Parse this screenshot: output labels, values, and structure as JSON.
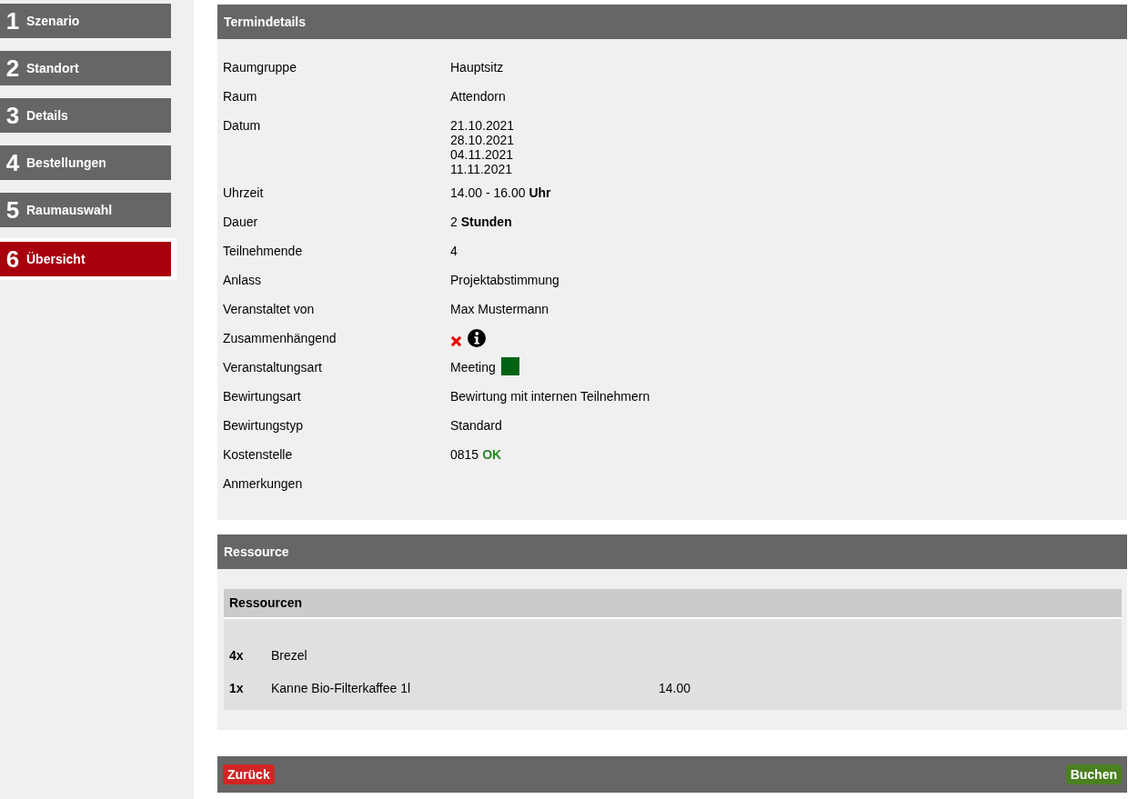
{
  "steps": [
    {
      "number": "1",
      "label": "Szenario",
      "selected": false
    },
    {
      "number": "2",
      "label": "Standort",
      "selected": false
    },
    {
      "number": "3",
      "label": "Details",
      "selected": false
    },
    {
      "number": "4",
      "label": "Bestellungen",
      "selected": false
    },
    {
      "number": "5",
      "label": "Raumauswahl",
      "selected": false
    },
    {
      "number": "6",
      "label": "Übersicht",
      "selected": true
    }
  ],
  "details": {
    "title": "Termindetails",
    "rows": [
      {
        "kind": "text",
        "label": "Raumgruppe",
        "value": "Hauptsitz"
      },
      {
        "kind": "text",
        "label": "Raum",
        "value": "Attendorn"
      },
      {
        "kind": "lines",
        "label": "Datum",
        "lines": [
          "21.10.2021",
          "28.10.2021",
          "04.11.2021",
          "11.11.2021"
        ]
      },
      {
        "kind": "text",
        "label": "Uhrzeit",
        "value": "14.00 - 16.00 **Uhr**"
      },
      {
        "kind": "text",
        "label": "Dauer",
        "value": "2   **Stunden**"
      },
      {
        "kind": "text",
        "label": "Teilnehmende",
        "value": "4"
      },
      {
        "kind": "text",
        "label": "Anlass",
        "value": "Projektabstimmung"
      },
      {
        "kind": "text",
        "label": "Veranstaltet von",
        "value": "Max Mustermann"
      },
      {
        "kind": "flag",
        "label": "Zusammenhängend",
        "on": false
      },
      {
        "kind": "swatch",
        "label": "Veranstaltungsart",
        "value": "Meeting",
        "color": "#006414"
      },
      {
        "kind": "text",
        "label": "Bewirtungsart",
        "value": "Bewirtung mit internen Teilnehmern"
      },
      {
        "kind": "text",
        "label": "Bewirtungstyp",
        "value": "Standard"
      },
      {
        "kind": "status",
        "label": "Kostenstelle",
        "value": "0815",
        "status": "OK"
      },
      {
        "kind": "text",
        "label": "Anmerkungen"
      }
    ]
  },
  "resources": {
    "title": "Ressource",
    "table_title": "Ressourcen",
    "items": [
      {
        "quantity": "4x",
        "name": "Brezel"
      },
      {
        "quantity": "1x",
        "name": "Kanne Bio-Filterkaffee 1l",
        "price": "14.00"
      }
    ]
  },
  "footer": {
    "back": "Zurück",
    "book": "Buchen"
  }
}
